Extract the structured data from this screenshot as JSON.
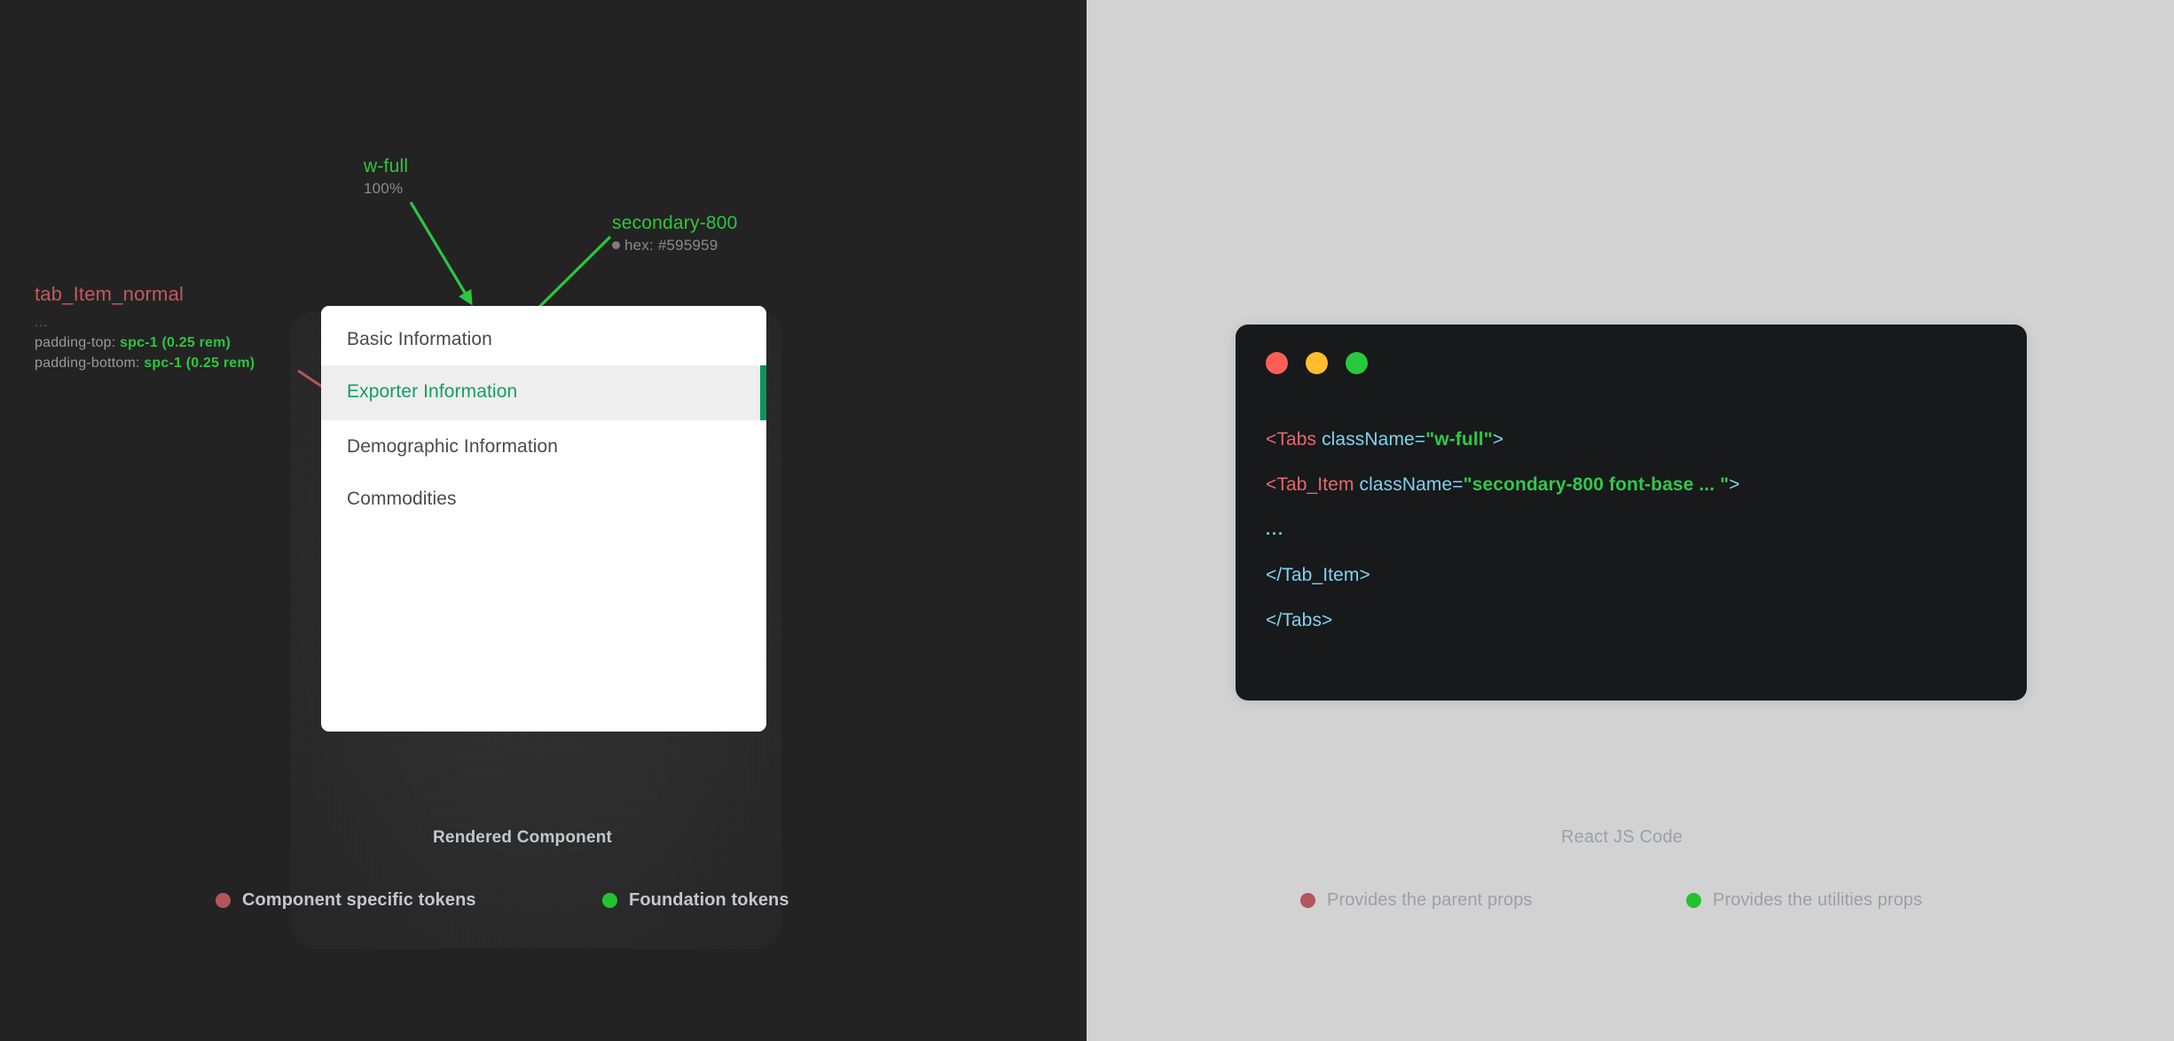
{
  "colors": {
    "dark_bg": "#232323",
    "light_bg": "#d2d2d2",
    "accent_green": "#2cc63f",
    "accent_red": "#c4595e",
    "tab_active_green": "#13a05f",
    "indicator_green": "#0a9558",
    "code_bg": "#17191b",
    "traffic_red": "#ff5f56",
    "traffic_yellow": "#ffbd2e",
    "traffic_green": "#27c93f"
  },
  "left_panel": {
    "caption": "Rendered Component",
    "annotations": {
      "w_full": {
        "token": "w-full",
        "value": "100%"
      },
      "secondary_800": {
        "token": "secondary-800",
        "hex_label": "hex: #595959"
      },
      "tab_item_normal": {
        "token": "tab_Item_normal",
        "ellipsis": "...",
        "props": [
          {
            "name": "padding-top:",
            "value": "spc-1 (0.25 rem)"
          },
          {
            "name": "padding-bottom:",
            "value": "spc-1 (0.25 rem)"
          }
        ]
      }
    },
    "tabs": [
      {
        "label": "Basic Information",
        "active": false
      },
      {
        "label": "Exporter Information",
        "active": true
      },
      {
        "label": "Demographic Information",
        "active": false
      },
      {
        "label": "Commodities",
        "active": false
      }
    ],
    "legend": [
      {
        "dot_color": "#b4555c",
        "label": "Component specific tokens"
      },
      {
        "dot_color": "#22c32f",
        "label": "Foundation tokens"
      }
    ]
  },
  "right_panel": {
    "caption": "React JS Code",
    "window": {
      "traffic_lights": [
        "close-dot",
        "minimize-dot",
        "maximize-dot"
      ]
    },
    "code_lines": [
      {
        "id": "line-tabs-open",
        "tag_open": "<Tabs ",
        "attr": "className=",
        "quote_open": "\"",
        "value": "w-full",
        "quote_close": "\"",
        "tag_close": ">"
      },
      {
        "id": "line-tabitem-open",
        "tag_open": "<Tab_Item ",
        "attr": "className=",
        "quote_open": "\"",
        "value": "secondary-800 font-base ... ",
        "quote_close": "\"",
        "tag_close": ">"
      },
      {
        "id": "line-ellipsis",
        "text": "..."
      },
      {
        "id": "line-tabitem-close",
        "text": "</Tab_Item>"
      },
      {
        "id": "line-tabs-close",
        "text": "</Tabs>"
      }
    ],
    "legend": [
      {
        "dot_color": "#b4555c",
        "label": "Provides the parent props"
      },
      {
        "dot_color": "#22c32f",
        "label": "Provides the utilities props"
      }
    ]
  }
}
